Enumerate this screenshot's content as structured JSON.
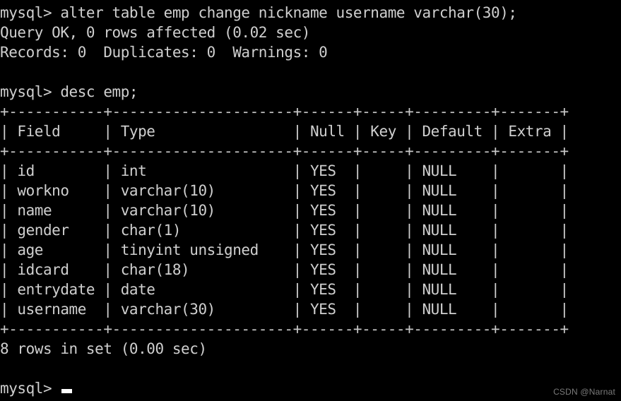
{
  "terminal": {
    "background_color": "#000000",
    "text_color": "#cfcfcf",
    "prompt": "mysql>",
    "lines": [
      {
        "id": "cmd-alter",
        "text": "mysql> alter table emp change nickname username varchar(30);"
      },
      {
        "id": "result-query-ok",
        "text": "Query OK, 0 rows affected (0.02 sec)"
      },
      {
        "id": "result-records",
        "text": "Records: 0  Duplicates: 0  Warnings: 0"
      },
      {
        "id": "blank-1",
        "text": " "
      },
      {
        "id": "cmd-desc",
        "text": "mysql> desc emp;"
      },
      {
        "id": "table-top-border",
        "text": "+-----------+---------------------+------+-----+---------+-------+"
      },
      {
        "id": "table-header-row",
        "text": "| Field     | Type                | Null | Key | Default | Extra |"
      },
      {
        "id": "table-header-sep",
        "text": "+-----------+---------------------+------+-----+---------+-------+"
      },
      {
        "id": "row-id",
        "text": "| id        | int                 | YES  |     | NULL    |       |"
      },
      {
        "id": "row-workno",
        "text": "| workno    | varchar(10)         | YES  |     | NULL    |       |"
      },
      {
        "id": "row-name",
        "text": "| name      | varchar(10)         | YES  |     | NULL    |       |"
      },
      {
        "id": "row-gender",
        "text": "| gender    | char(1)             | YES  |     | NULL    |       |"
      },
      {
        "id": "row-age",
        "text": "| age       | tinyint unsigned    | YES  |     | NULL    |       |"
      },
      {
        "id": "row-idcard",
        "text": "| idcard    | char(18)            | YES  |     | NULL    |       |"
      },
      {
        "id": "row-entrydate",
        "text": "| entrydate | date                | YES  |     | NULL    |       |"
      },
      {
        "id": "row-username",
        "text": "| username  | varchar(30)         | YES  |     | NULL    |       |"
      },
      {
        "id": "table-bottom-border",
        "text": "+-----------+---------------------+------+-----+---------+-------+"
      },
      {
        "id": "result-rowcount",
        "text": "8 rows in set (0.00 sec)"
      },
      {
        "id": "blank-2",
        "text": " "
      }
    ],
    "final_prompt": "mysql> ",
    "cursor": "cursor-block"
  },
  "sql": {
    "alter_statement": "alter table emp change nickname username varchar(30);",
    "desc_statement": "desc emp;",
    "table_name": "emp",
    "old_column": "nickname",
    "new_column": "username",
    "new_type": "varchar(30)",
    "query_status": "Query OK",
    "rows_affected": "0 rows affected",
    "alter_duration": "(0.02 sec)",
    "records": "Records: 0",
    "duplicates": "Duplicates: 0",
    "warnings": "Warnings: 0",
    "rowcount_summary": "8 rows in set (0.00 sec)"
  },
  "describe_table": {
    "columns": [
      "Field",
      "Type",
      "Null",
      "Key",
      "Default",
      "Extra"
    ],
    "rows": [
      {
        "field": "id",
        "type": "int",
        "null": "YES",
        "key": "",
        "default": "NULL",
        "extra": ""
      },
      {
        "field": "workno",
        "type": "varchar(10)",
        "null": "YES",
        "key": "",
        "default": "NULL",
        "extra": ""
      },
      {
        "field": "name",
        "type": "varchar(10)",
        "null": "YES",
        "key": "",
        "default": "NULL",
        "extra": ""
      },
      {
        "field": "gender",
        "type": "char(1)",
        "null": "YES",
        "key": "",
        "default": "NULL",
        "extra": ""
      },
      {
        "field": "age",
        "type": "tinyint unsigned",
        "null": "YES",
        "key": "",
        "default": "NULL",
        "extra": ""
      },
      {
        "field": "idcard",
        "type": "char(18)",
        "null": "YES",
        "key": "",
        "default": "NULL",
        "extra": ""
      },
      {
        "field": "entrydate",
        "type": "date",
        "null": "YES",
        "key": "",
        "default": "NULL",
        "extra": ""
      },
      {
        "field": "username",
        "type": "varchar(30)",
        "null": "YES",
        "key": "",
        "default": "NULL",
        "extra": ""
      }
    ],
    "row_count": 8
  },
  "watermark": {
    "text": "CSDN @Narnat",
    "color": "#7a7a7a"
  }
}
